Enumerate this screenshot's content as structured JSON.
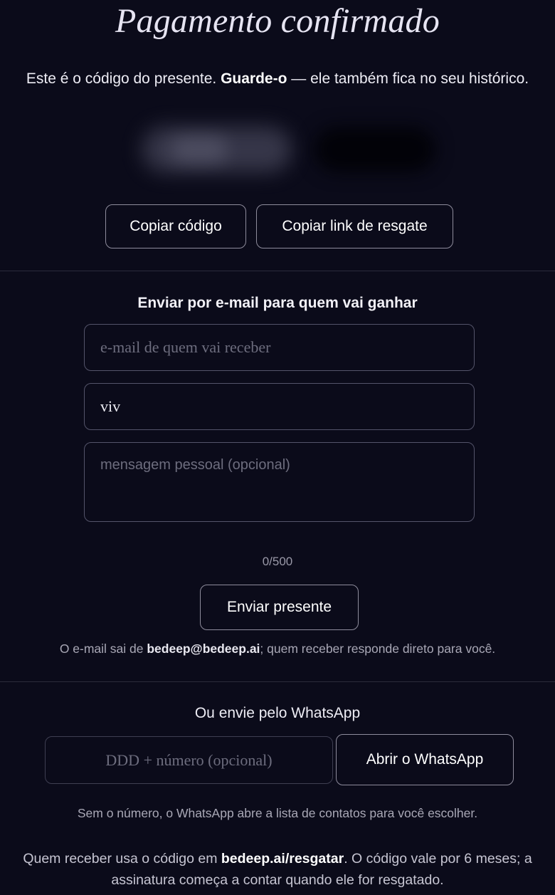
{
  "header": {
    "title": "Pagamento confirmado",
    "intro_before": "Este é o código do presente. ",
    "intro_bold": "Guarde-o",
    "intro_after": " — ele também fica no seu histórico."
  },
  "actions": {
    "copy_code": "Copiar código",
    "copy_link": "Copiar link de resgate"
  },
  "email_section": {
    "title": "Enviar por e-mail para quem vai ganhar",
    "email_placeholder": "e-mail de quem vai receber",
    "email_value": "",
    "name_value": "viv",
    "message_placeholder": "mensagem pessoal (opcional)",
    "message_value": "",
    "counter": "0/500",
    "send_label": "Enviar presente",
    "note_before": "O e-mail sai de ",
    "note_bold": "bedeep@bedeep.ai",
    "note_after": "; quem receber responde direto para você."
  },
  "whatsapp_section": {
    "title": "Ou envie pelo WhatsApp",
    "phone_placeholder": "DDD + número (opcional)",
    "phone_value": "",
    "open_label": "Abrir o WhatsApp",
    "note": "Sem o número, o WhatsApp abre a lista de contatos para você escolher."
  },
  "footer": {
    "before": "Quem receber usa o código em ",
    "bold": "bedeep.ai/resgatar",
    "after_line1": ". O código vale por 6 meses; a",
    "line2": "assinatura começa a contar quando ele for resgatado."
  }
}
